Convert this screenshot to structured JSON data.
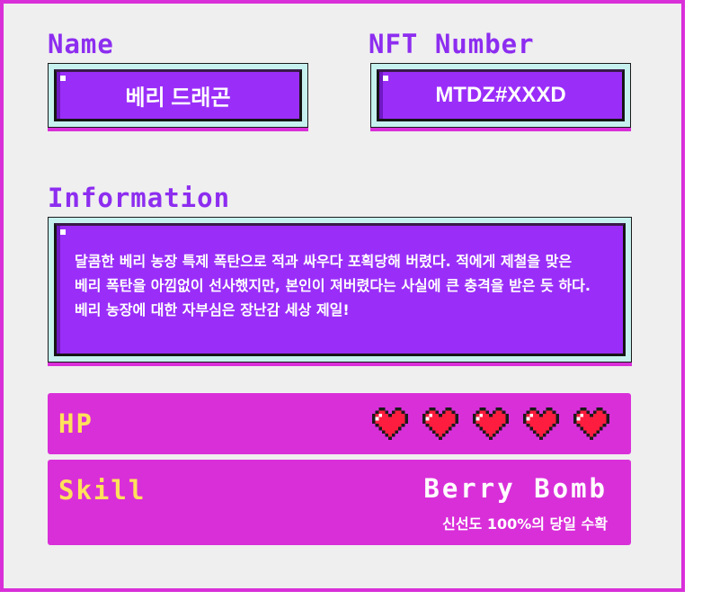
{
  "name_section": {
    "label": "Name",
    "value": "베리 드래곤"
  },
  "nft_section": {
    "label": "NFT Number",
    "value": "MTDZ#XXXD"
  },
  "info_section": {
    "label": "Information",
    "lines": [
      "달콤한 베리 농장 특제 폭탄으로 적과 싸우다 포획당해 버렸다. 적에게 제철을 맞은",
      "베리 폭탄을 아낌없이 선사했지만, 본인이 져버렸다는 사실에 큰 충격을 받은 듯 하다.",
      "베리 농장에 대한 자부심은 장난감 세상 제일!"
    ]
  },
  "hp": {
    "label": "HP",
    "hearts": 5,
    "max_hearts": 5,
    "icon": "heart-icon",
    "heart_color": "#ff1d3f"
  },
  "skill": {
    "label": "Skill",
    "name": "Berry Bomb",
    "description": "신선도 100%의 당일 수확"
  },
  "colors": {
    "border": "#d92fd9",
    "accent": "#8d2df0",
    "field": "#9a2ef8",
    "label_yellow": "#ffe15a"
  }
}
